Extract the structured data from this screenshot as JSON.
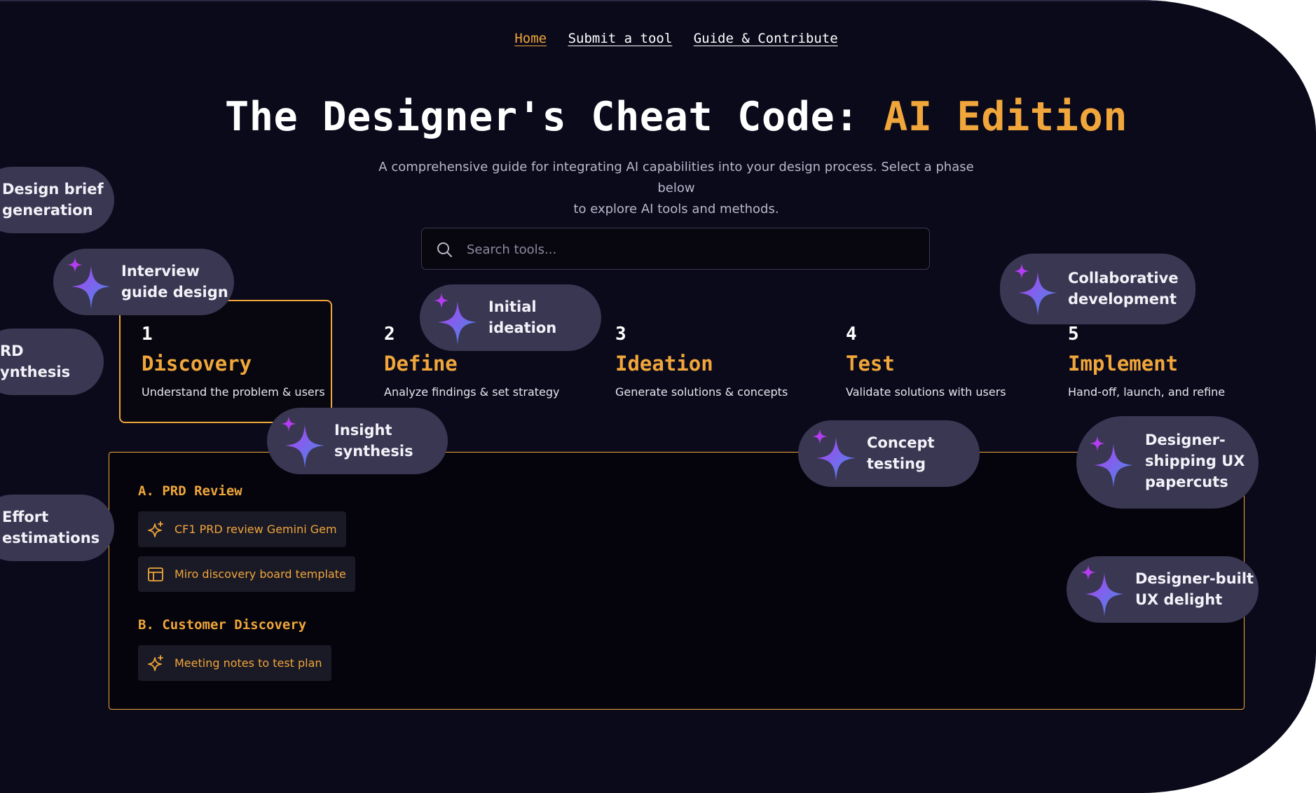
{
  "nav": {
    "items": [
      "Home",
      "Submit a tool",
      "Guide & Contribute"
    ],
    "active": "Home"
  },
  "header": {
    "title_main": "The Designer's Cheat Code:",
    "title_accent": "AI Edition",
    "subtitle_line1": "A comprehensive guide for integrating AI capabilities into your design process. Select a phase below",
    "subtitle_line2": "to explore AI tools and methods."
  },
  "search": {
    "placeholder": "Search tools..."
  },
  "phases": [
    {
      "num": "1",
      "name": "Discovery",
      "desc": "Understand the problem & users",
      "selected": true
    },
    {
      "num": "2",
      "name": "Define",
      "desc": "Analyze findings & set strategy"
    },
    {
      "num": "3",
      "name": "Ideation",
      "desc": "Generate solutions & concepts"
    },
    {
      "num": "4",
      "name": "Test",
      "desc": "Validate solutions with users"
    },
    {
      "num": "5",
      "name": "Implement",
      "desc": "Hand-off, launch, and refine"
    }
  ],
  "content": {
    "sections": [
      {
        "title": "A. PRD Review",
        "tools": [
          {
            "label": "CF1 PRD review Gemini Gem",
            "icon": "sparkle-icon"
          },
          {
            "label": "Miro discovery board template",
            "icon": "template-icon"
          }
        ]
      },
      {
        "title": "B. Customer Discovery",
        "tools": [
          {
            "label": "Meeting notes to test plan",
            "icon": "sparkle-icon"
          }
        ]
      }
    ]
  },
  "bubbles": {
    "design_brief": [
      "Design brief",
      "generation"
    ],
    "interview_guide": [
      "Interview",
      "guide design"
    ],
    "prd_synthesis": [
      "RD",
      "ynthesis"
    ],
    "effort_estimations": [
      "Effort",
      "estimations"
    ],
    "initial_ideation": [
      "Initial",
      "ideation"
    ],
    "insight_synthesis": [
      "Insight",
      "synthesis"
    ],
    "collaborative_dev": [
      "Collaborative",
      "development"
    ],
    "concept_testing": [
      "Concept",
      "testing"
    ],
    "designer_shipping": [
      "Designer-",
      "shipping UX",
      "papercuts"
    ],
    "designer_built": [
      "Designer-built",
      "UX delight"
    ]
  },
  "colors": {
    "background": "#0b0a1b",
    "accent": "#f0a63a",
    "bubble": "#3a3753",
    "spark_top": "#b53cf0",
    "spark_bottom": "#3f8fe8"
  }
}
